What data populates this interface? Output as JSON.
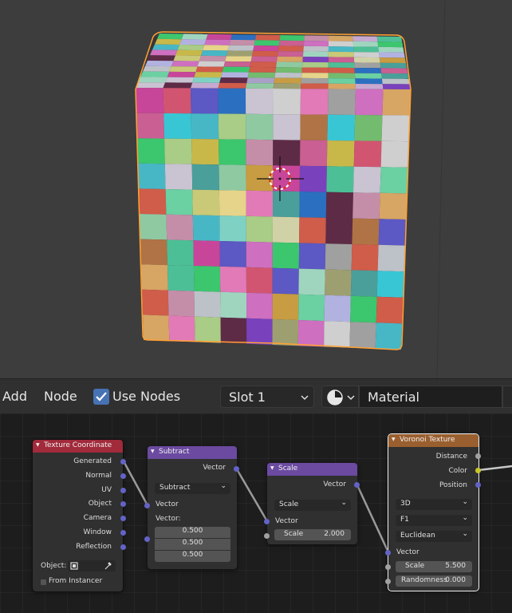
{
  "header": {
    "add_label": "Add",
    "node_label": "Node",
    "use_nodes_label": "Use Nodes",
    "slot_value": "Slot 1",
    "material_name": "Material"
  },
  "nodes": {
    "texture_coordinate": {
      "title": "Texture Coordinate",
      "header_color": "#a12a3b",
      "outputs": [
        "Generated",
        "Normal",
        "UV",
        "Object",
        "Camera",
        "Window",
        "Reflection"
      ],
      "object_label": "Object:",
      "from_instancer_label": "From Instancer"
    },
    "subtract": {
      "title": "Subtract",
      "header_color": "#6b4aa0",
      "output_label": "Vector",
      "operation": "Subtract",
      "input_label": "Vector",
      "vector_label": "Vector:",
      "values": [
        "0.500",
        "0.500",
        "0.500"
      ]
    },
    "scale": {
      "title": "Scale",
      "header_color": "#6b4aa0",
      "output_label": "Vector",
      "operation": "Scale",
      "input_label": "Vector",
      "scale_label": "Scale",
      "scale_value": "2.000"
    },
    "voronoi": {
      "title": "Voronoi Texture",
      "header_color": "#9a5f2f",
      "outputs": [
        "Distance",
        "Color",
        "Position"
      ],
      "dimensions": "3D",
      "feature": "F1",
      "metric": "Euclidean",
      "input_label": "Vector",
      "scale_label": "Scale",
      "scale_value": "5.500",
      "randomness_label": "Randomness",
      "randomness_value": "0.000"
    }
  },
  "colors": {
    "vector_socket": "#6363c7",
    "float_socket": "#a1a1a1",
    "color_socket": "#c7c729",
    "selection_outline": "#ffa033",
    "use_nodes_check": "#4772b3"
  }
}
